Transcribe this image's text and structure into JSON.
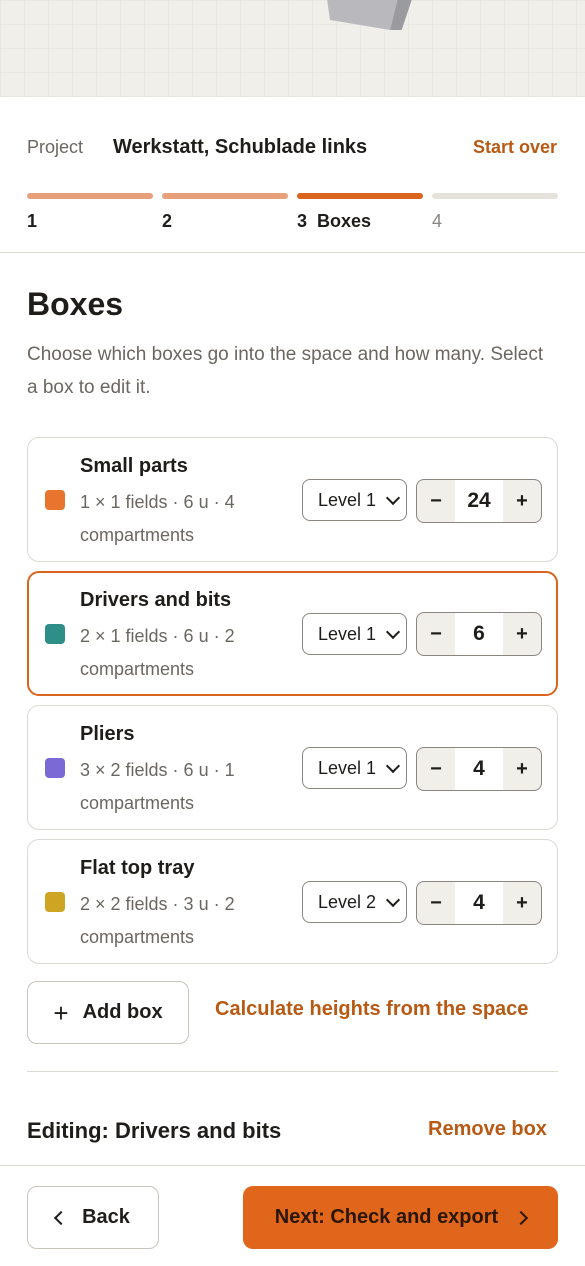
{
  "project": {
    "label": "Project",
    "name": "Werkstatt, Schublade links",
    "start_over": "Start over"
  },
  "steps": [
    {
      "label": "1",
      "state": "done"
    },
    {
      "label": "2",
      "state": "done"
    },
    {
      "label": "3  Boxes",
      "state": "active"
    },
    {
      "label": "4",
      "state": "future"
    }
  ],
  "section": {
    "title": "Boxes",
    "description": "Choose which boxes go into the space and how many. Select a box to edit it."
  },
  "boxes": [
    {
      "name": "Small parts",
      "meta": "1 × 1 fields · 6 u · 4 compartments",
      "color": "#e8742e",
      "level": "Level 1",
      "count": "24",
      "selected": false
    },
    {
      "name": "Drivers and bits",
      "meta": "2 × 1 fields · 6 u · 2 compartments",
      "color": "#2e8e88",
      "level": "Level 1",
      "count": "6",
      "selected": true
    },
    {
      "name": "Pliers",
      "meta": "3 × 2 fields · 6 u · 1 compartments",
      "color": "#7b6ad6",
      "level": "Level 1",
      "count": "4",
      "selected": false
    },
    {
      "name": "Flat top tray",
      "meta": "2 × 2 fields · 3 u · 2 compartments",
      "color": "#cda523",
      "level": "Level 2",
      "count": "4",
      "selected": false
    }
  ],
  "stepper": {
    "minus": "−",
    "plus": "+"
  },
  "actions": {
    "add_box": "Add box",
    "calculate": "Calculate heights from the space"
  },
  "editing": {
    "title": "Editing: Drivers and bits",
    "remove": "Remove box"
  },
  "footer": {
    "back": "Back",
    "next": "Next: Check and export"
  },
  "colors": {
    "accent": "#e0661c",
    "accent_text": "#b85a14",
    "step_done": "#e7a07a",
    "step_active": "#d9641e",
    "step_future": "#e4e2db"
  }
}
